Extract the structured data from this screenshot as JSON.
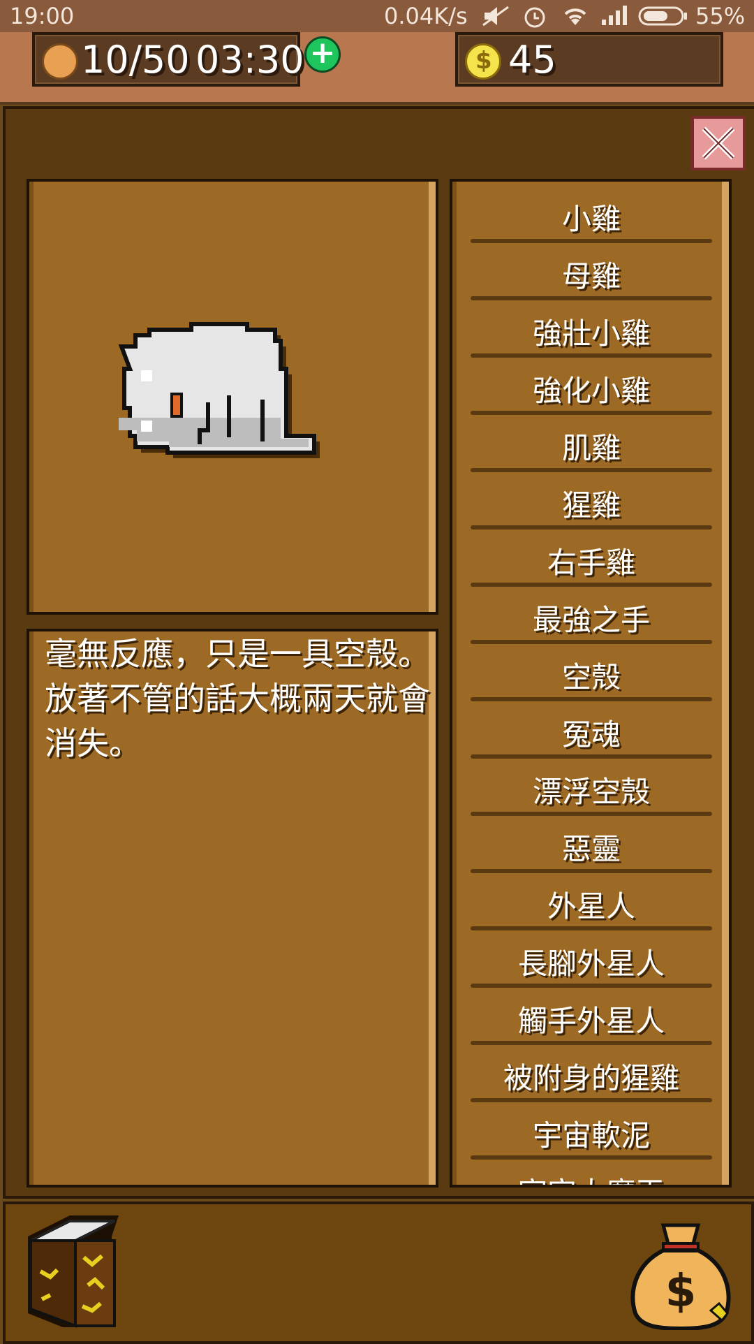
{
  "status_bar": {
    "time": "19:00",
    "network_speed": "0.04K/s",
    "battery": "55%"
  },
  "resources": {
    "energy": "10/50",
    "timer": "03:30",
    "coins": "45"
  },
  "description": "毫無反應，只是一具空殼。\n放著不管的話大概兩天就會消失。",
  "list": {
    "items": [
      "小雞",
      "母雞",
      "強壯小雞",
      "強化小雞",
      "肌雞",
      "猩雞",
      "右手雞",
      "最強之手",
      "空殼",
      "冤魂",
      "漂浮空殼",
      "惡靈",
      "外星人",
      "長腳外星人",
      "觸手外星人",
      "被附身的猩雞",
      "宇宙軟泥",
      "宇宙大魔王"
    ]
  },
  "colors": {
    "panel_brown": "#9c6a24",
    "dark_brown": "#5a3a10",
    "text": "#ffffff",
    "close_button": "#e79a9a"
  },
  "icons": {
    "energy": "cookie-icon",
    "coins": "coin-icon",
    "add": "plus-icon",
    "close": "close-icon",
    "book": "book-icon",
    "shop": "money-bag-icon"
  }
}
